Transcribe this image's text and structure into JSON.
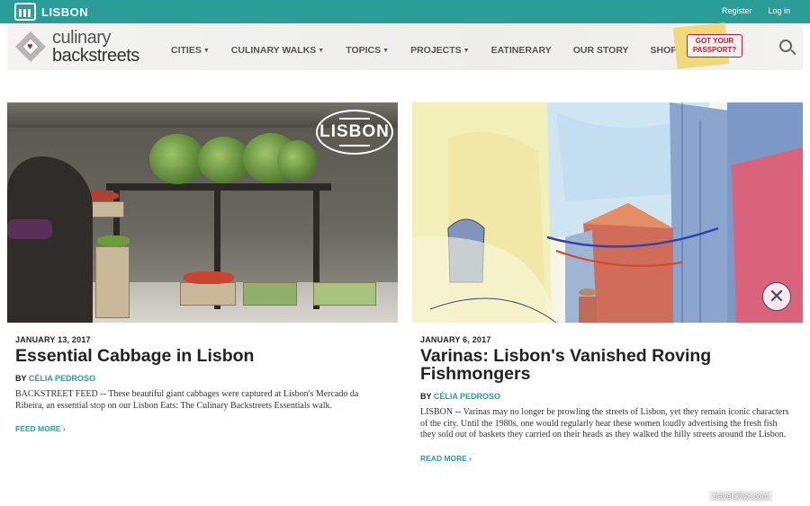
{
  "top_bar": {
    "city": "LISBON",
    "register": "Register",
    "login": "Log in",
    "color": "#2a9d99"
  },
  "brand": {
    "line1": "culinary",
    "line2": "backstreets"
  },
  "nav": {
    "items": [
      {
        "label": "CITIES",
        "has_dropdown": true
      },
      {
        "label": "CULINARY WALKS",
        "has_dropdown": true
      },
      {
        "label": "TOPICS",
        "has_dropdown": true
      },
      {
        "label": "PROJECTS",
        "has_dropdown": true
      },
      {
        "label": "EATINERARY",
        "has_dropdown": false
      },
      {
        "label": "OUR STORY",
        "has_dropdown": false
      },
      {
        "label": "SHOP",
        "has_dropdown": false
      }
    ],
    "caret": "▼",
    "passport_line1": "GOT YOUR",
    "passport_line2": "PASSPORT?"
  },
  "articles": [
    {
      "image_badge": "LISBON",
      "date": "JANUARY 13, 2017",
      "title": "Essential Cabbage in Lisbon",
      "by": "BY",
      "author": "CÉLIA PEDROSO",
      "excerpt": "BACKSTREET FEED -- These beautiful giant cabbages were captured at Lisbon's Mercado da Ribeira, an essential stop on our Lisbon Eats: The Culinary Backstreets Essentials walk.",
      "link": "FEED MORE ›"
    },
    {
      "date": "JANUARY 6, 2017",
      "title": "Varinas: Lisbon's Vanished Roving Fishmongers",
      "by": "BY",
      "author": "CÉLIA PEDROSO",
      "excerpt": "LISBON -- Varinas may no longer be prowling the streets of Lisbon, yet they remain iconic characters of the city. Until the 1980s, one would regularly hear these women loudly advertising the fresh fish they sold out of baskets they carried on their heads as they walked the hilly streets around the Lisbon.",
      "link": "READ MORE ›",
      "close_glyph": "✕"
    }
  ],
  "watermark": "travel.kllvx.com"
}
